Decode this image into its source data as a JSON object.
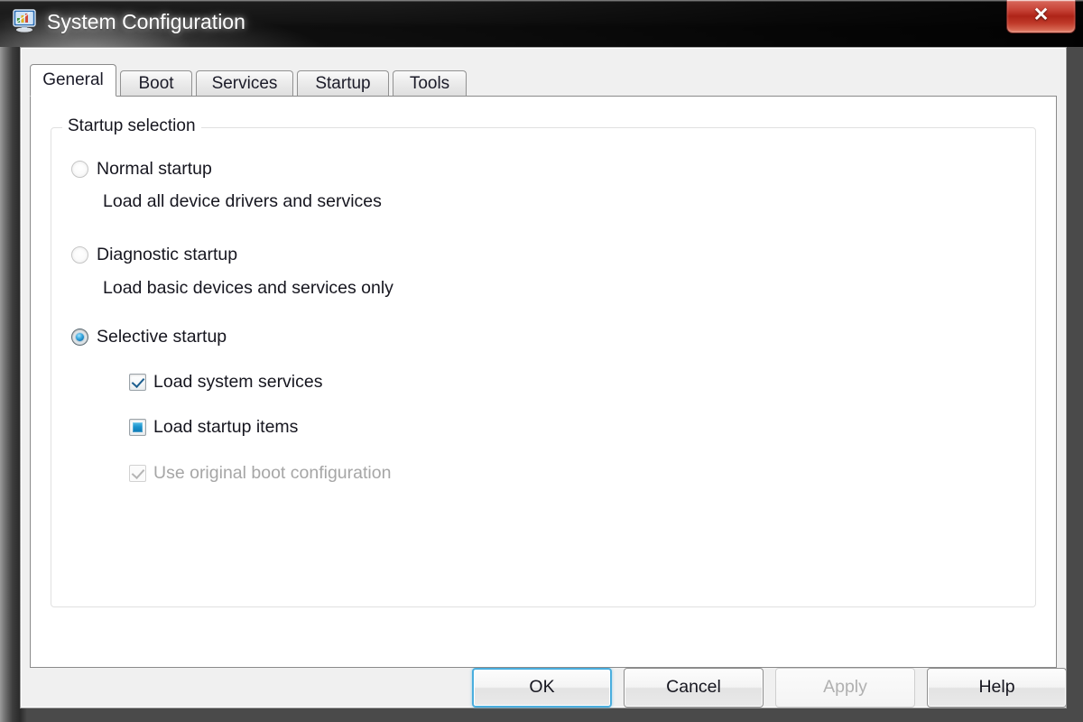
{
  "window": {
    "title": "System Configuration",
    "icon": "system-configuration-monitor-icon",
    "close_label": "✕",
    "accent_focus_color": "#4aaede",
    "titlebar_color": "#2c2c2c"
  },
  "tabs": [
    {
      "label": "General",
      "active": true
    },
    {
      "label": "Boot",
      "active": false
    },
    {
      "label": "Services",
      "active": false
    },
    {
      "label": "Startup",
      "active": false
    },
    {
      "label": "Tools",
      "active": false
    }
  ],
  "general": {
    "group_label": "Startup selection",
    "options": [
      {
        "label": "Normal startup",
        "description": "Load all device drivers and services",
        "selected": false
      },
      {
        "label": "Diagnostic startup",
        "description": "Load basic devices and services only",
        "selected": false
      },
      {
        "label": "Selective startup",
        "description": "",
        "selected": true
      }
    ],
    "selective_options": [
      {
        "label": "Load system services",
        "state": "checked",
        "enabled": true
      },
      {
        "label": "Load startup items",
        "state": "indeterminate",
        "enabled": true
      },
      {
        "label": "Use original boot configuration",
        "state": "checked",
        "enabled": false
      }
    ]
  },
  "footer": {
    "buttons": [
      {
        "label": "OK",
        "style": "default",
        "enabled": true
      },
      {
        "label": "Cancel",
        "style": "normal",
        "enabled": true
      },
      {
        "label": "Apply",
        "style": "disabled",
        "enabled": false
      },
      {
        "label": "Help",
        "style": "normal",
        "enabled": true
      }
    ]
  }
}
